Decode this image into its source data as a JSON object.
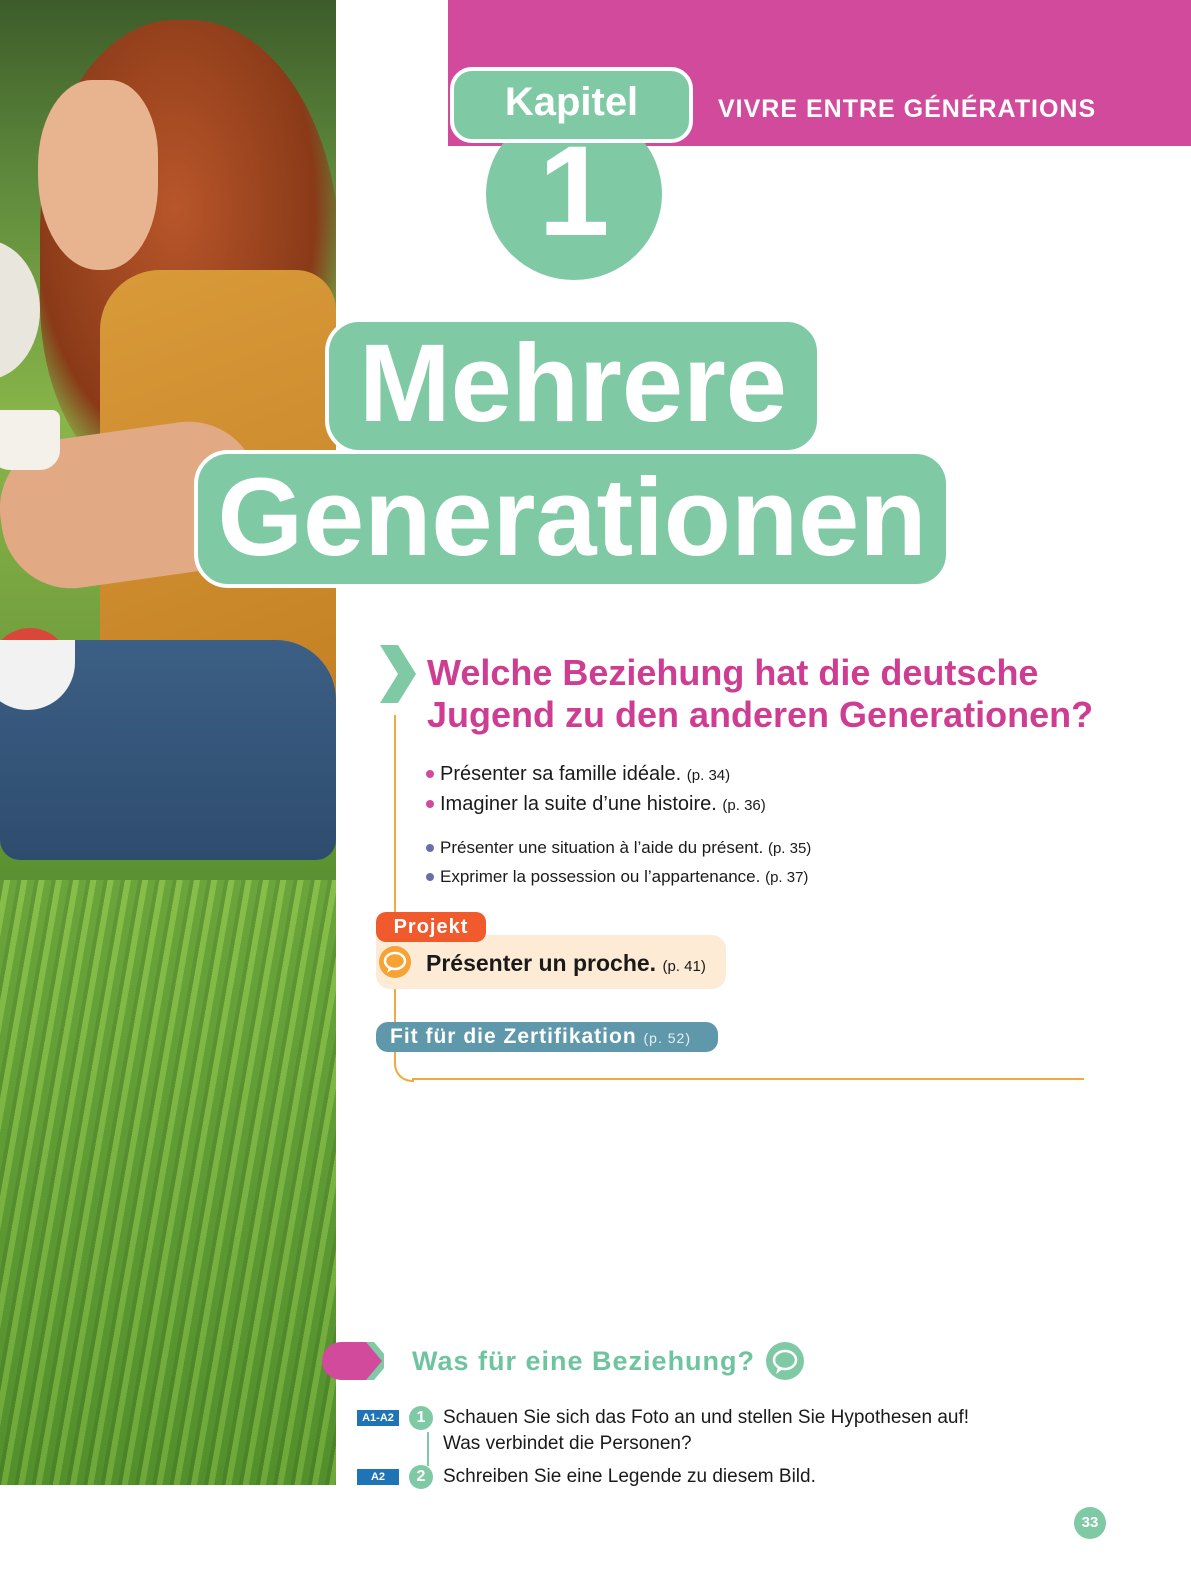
{
  "header": {
    "band_text": "VIVRE ENTRE GÉNÉRATIONS",
    "kapitel_label": "Kapitel",
    "kapitel_number": "1"
  },
  "title": {
    "line1": "Mehrere",
    "line2": "Generationen"
  },
  "question": {
    "line1": "Welche Beziehung hat die deutsche",
    "line2": "Jugend zu den anderen Generationen?"
  },
  "objectives": [
    {
      "text": "Présenter sa famille idéale.",
      "ref": "(p. 34)"
    },
    {
      "text": "Imaginer la suite d’une histoire.",
      "ref": "(p. 36)"
    }
  ],
  "grammar": [
    {
      "text": "Présenter une situation à l’aide du présent.",
      "ref": "(p. 35)"
    },
    {
      "text": "Exprimer la possession ou l’appartenance.",
      "ref": "(p. 37)"
    }
  ],
  "projekt": {
    "tag": "Projekt",
    "text": "Présenter un proche.",
    "ref": "(p. 41)"
  },
  "fit": {
    "text": "Fit für die Zertifikation",
    "ref": "(p. 52)"
  },
  "section": {
    "title": "Was für eine Beziehung?"
  },
  "exercises": [
    {
      "level": "A1-A2",
      "number": "1",
      "line1": "Schauen Sie sich das Foto an und stellen Sie Hypothesen auf!",
      "line2": "Was verbindet die Personen?"
    },
    {
      "level": "A2",
      "number": "2",
      "line1": "Schreiben Sie eine Legende zu diesem Bild."
    }
  ],
  "page_number": "33",
  "colors": {
    "pink": "#d14a9b",
    "green": "#7fc9a5",
    "orange": "#f05a2c",
    "orange_line": "#f0a93a",
    "teal": "#5e98aa",
    "level_blue": "#1f74b6"
  }
}
